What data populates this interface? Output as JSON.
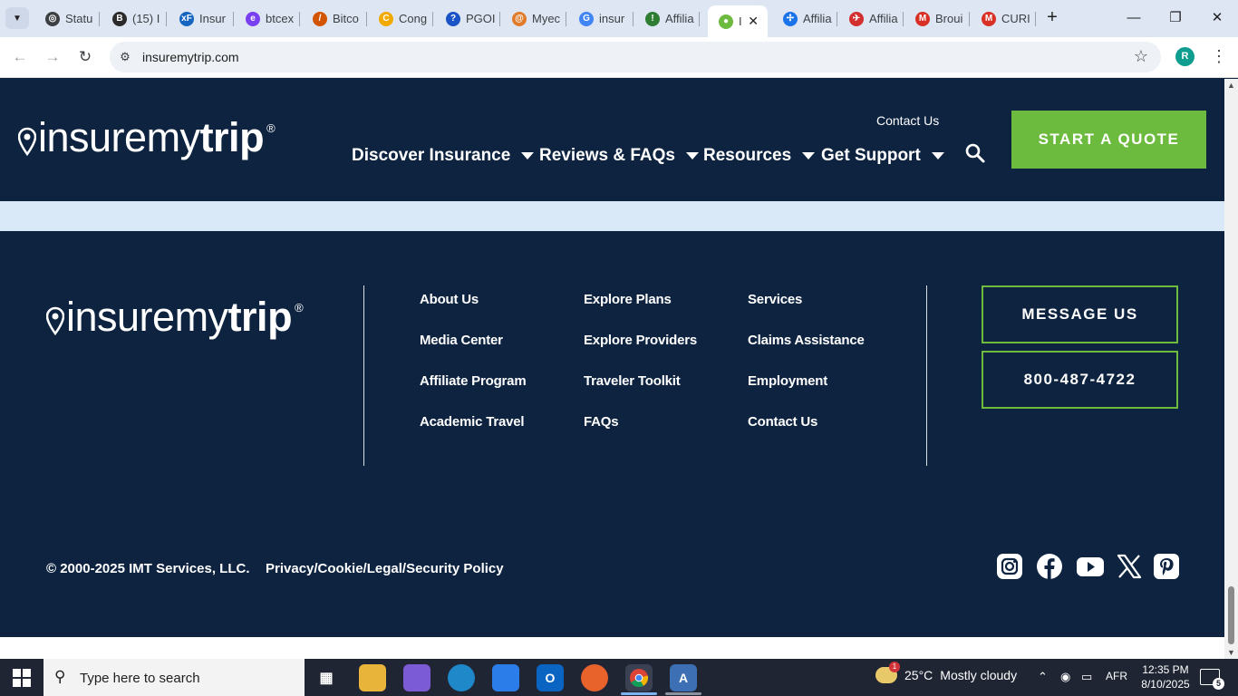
{
  "browser": {
    "tabs": [
      {
        "title": "Statu",
        "icon": "chatgpt-icon",
        "color": "#3c4043"
      },
      {
        "title": "(15) I",
        "icon": "bitcointalk-icon",
        "color": "#2b2b2b"
      },
      {
        "title": "Insur",
        "icon": "xenforo-icon",
        "color": "#1565c0"
      },
      {
        "title": "btcex",
        "icon": "letter-e-icon",
        "color": "#7b3ff2"
      },
      {
        "title": "Bitco",
        "icon": "feather-icon",
        "color": "#d35400"
      },
      {
        "title": "Cong",
        "icon": "letter-c-icon",
        "color": "#f2a900"
      },
      {
        "title": "PGOI",
        "icon": "question-icon",
        "color": "#1a53c5"
      },
      {
        "title": "Myec",
        "icon": "swirl-icon",
        "color": "#e07b2a"
      },
      {
        "title": "insur",
        "icon": "google-icon",
        "color": "#4285f4"
      },
      {
        "title": "Affilia",
        "icon": "runner-icon",
        "color": "#2e7d32"
      },
      {
        "title": "I",
        "icon": "map-pin-icon",
        "color": "#6dbb3e",
        "active": true
      },
      {
        "title": "Affilia",
        "icon": "pinwheel-icon",
        "color": "#1a73e8"
      },
      {
        "title": "Affilia",
        "icon": "airline-icon",
        "color": "#d32f2f"
      },
      {
        "title": "Broui",
        "icon": "gmail-icon",
        "color": "#d93025"
      },
      {
        "title": "CURI",
        "icon": "gmail-icon",
        "color": "#d93025"
      }
    ],
    "url": "insuremytrip.com",
    "profile_initial": "R"
  },
  "site": {
    "logo": {
      "light": "insuremy",
      "bold": "trip",
      "reg": "®"
    },
    "header": {
      "contact_link": "Contact Us",
      "nav": [
        "Discover Insurance",
        "Reviews & FAQs",
        "Resources",
        "Get Support"
      ],
      "cta": "START A QUOTE"
    },
    "footer": {
      "columns": [
        [
          "About Us",
          "Media Center",
          "Affiliate Program",
          "Academic Travel"
        ],
        [
          "Explore Plans",
          "Explore Providers",
          "Traveler Toolkit",
          "FAQs"
        ],
        [
          "Services",
          "Claims Assistance",
          "Employment",
          "Contact Us"
        ]
      ],
      "message_button": "MESSAGE US",
      "phone": "800-487-4722",
      "copyright": "© 2000-2025 IMT Services, LLC.",
      "policy_link": "Privacy/Cookie/Legal/Security Policy",
      "social": [
        "instagram-icon",
        "facebook-icon",
        "youtube-icon",
        "x-icon",
        "pinterest-icon"
      ]
    },
    "colors": {
      "navy": "#0d2340",
      "green": "#6dbb3e",
      "band": "#d9e9f8"
    }
  },
  "taskbar": {
    "search_placeholder": "Type here to search",
    "weather": {
      "temp": "25°C",
      "condition": "Mostly cloudy",
      "badge": "1"
    },
    "language": "AFR",
    "time": "12:35 PM",
    "date": "8/10/2025",
    "notifications": "5"
  }
}
